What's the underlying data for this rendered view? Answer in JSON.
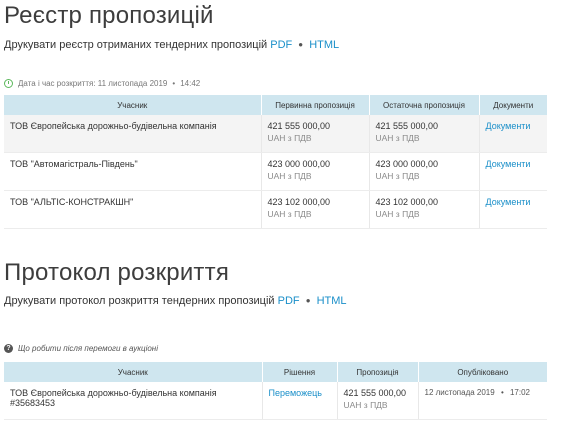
{
  "registry": {
    "title": "Реєстр пропозицій",
    "print_text": "Друкувати реєстр отриманих тендерних пропозицій",
    "pdf": "PDF",
    "html": "HTML",
    "meta": {
      "date_label": "Дата і час розкриття: 11 листопада 2019",
      "time": "14:42"
    },
    "columns": [
      "Учасник",
      "Первинна пропозиція",
      "Остаточна пропозиція",
      "Документи"
    ],
    "rows": [
      {
        "participant": "ТОВ Європейська дорожньо-будівельна компанія",
        "initial": "421 555 000,00",
        "initial_currency": "UAH з ПДВ",
        "final": "421 555 000,00",
        "final_currency": "UAH з ПДВ",
        "docs": "Документи"
      },
      {
        "participant": "ТОВ \"Автомагістраль-Південь\"",
        "initial": "423 000 000,00",
        "initial_currency": "UAH з ПДВ",
        "final": "423 000 000,00",
        "final_currency": "UAH з ПДВ",
        "docs": "Документи"
      },
      {
        "participant": "ТОВ \"АЛЬТІС-КОНСТРАКШН\"",
        "initial": "423 102 000,00",
        "initial_currency": "UAH з ПДВ",
        "final": "423 102 000,00",
        "final_currency": "UAH з ПДВ",
        "docs": "Документи"
      }
    ]
  },
  "protocol": {
    "title": "Протокол розкриття",
    "print_text": "Друкувати протокол розкриття тендерних пропозицій",
    "pdf": "PDF",
    "html": "HTML",
    "help": "Що робити після перемоги в аукціоні",
    "columns": [
      "Учасник",
      "Рішення",
      "Пропозиція",
      "Опубліковано"
    ],
    "rows": [
      {
        "participant": "ТОВ Європейська дорожньо-будівельна компанія #35683453",
        "decision": "Переможець",
        "amount": "421 555 000,00",
        "currency": "UAH з ПДВ",
        "published_date": "12 листопада 2019",
        "published_time": "17:02"
      }
    ]
  },
  "colors": {
    "link": "#1a8fc9",
    "header_bg": "#cfe6ef",
    "clock": "#5cb85c"
  }
}
